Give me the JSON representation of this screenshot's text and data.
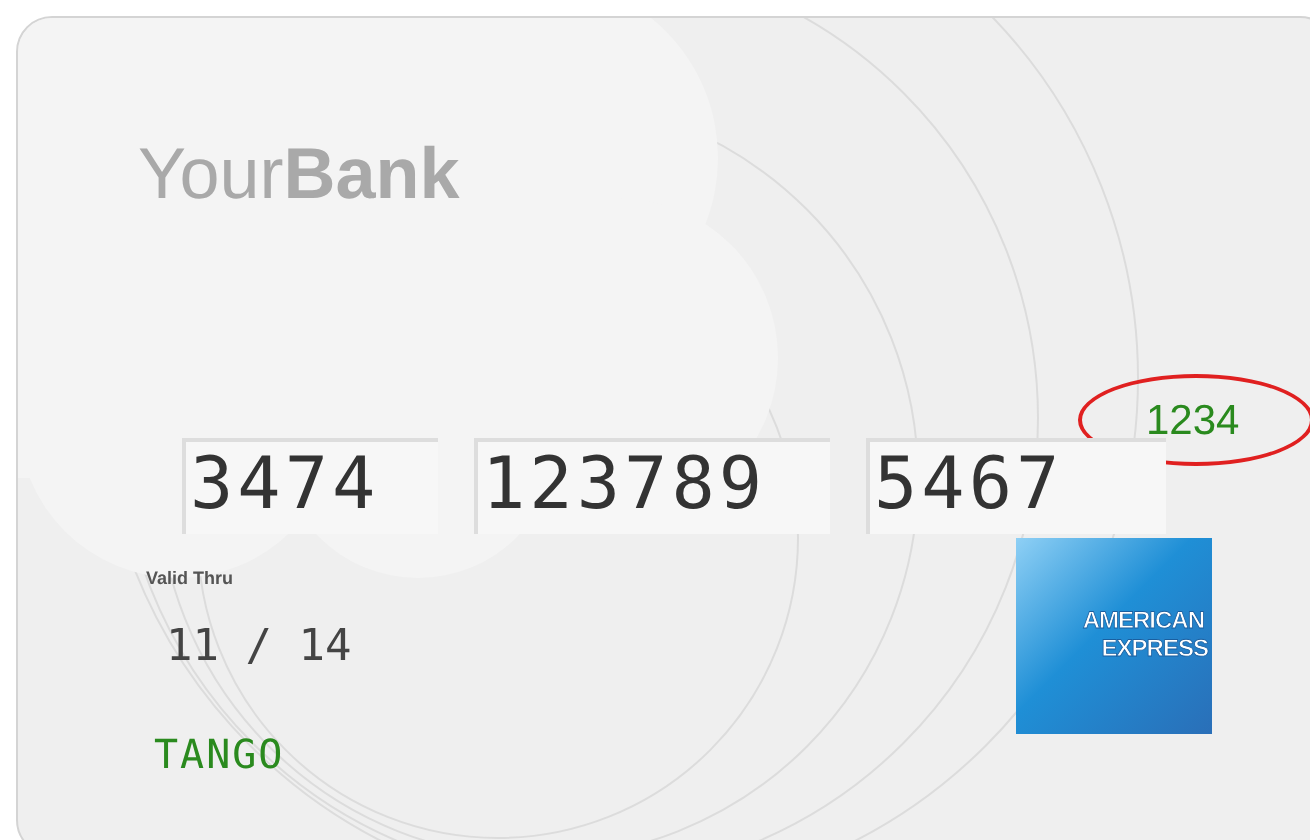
{
  "card": {
    "bank_logo": "Your**Bank**",
    "security_code": "1234",
    "number_fields": [
      {
        "value": "3474"
      },
      {
        "value": "123789"
      },
      {
        "value": "5467"
      }
    ],
    "valid_thru_label": "Valid Thru",
    "expiry": "11 / 14",
    "cardholder": "TANGO",
    "network_logo": [
      "AMERICAN",
      "EXPRESS"
    ]
  }
}
